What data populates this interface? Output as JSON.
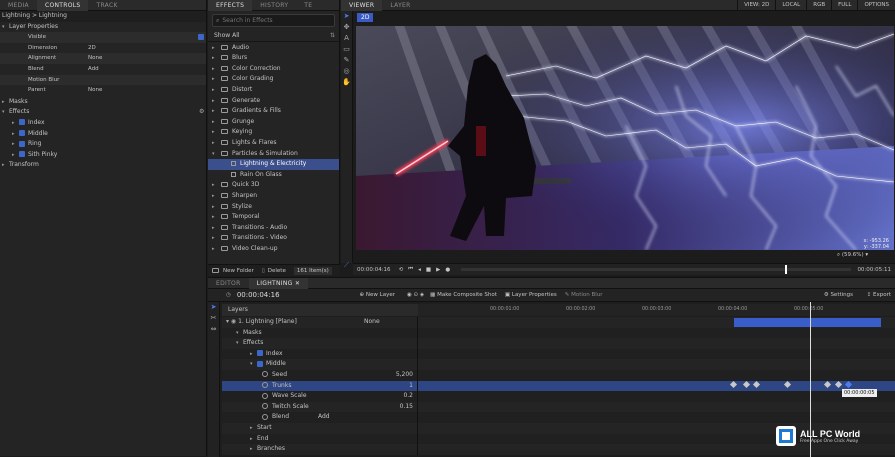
{
  "left_panel": {
    "tabs": [
      "MEDIA",
      "CONTROLS",
      "TRACK"
    ],
    "breadcrumb": "Lightning > Lightning",
    "props_title": "Layer Properties",
    "props": [
      {
        "label": "Visible",
        "value": ""
      },
      {
        "label": "Dimension",
        "value": "2D"
      },
      {
        "label": "Alignment",
        "value": "None"
      },
      {
        "label": "Blend",
        "value": "Add"
      },
      {
        "label": "Motion Blur",
        "value": ""
      },
      {
        "label": "Parent",
        "value": "None"
      }
    ],
    "masks": "Masks",
    "effects": "Effects",
    "effect_items": [
      "Index",
      "Middle",
      "Ring",
      "Sith Pinky"
    ],
    "transform": "Transform"
  },
  "effects_panel": {
    "tabs": [
      "EFFECTS",
      "HISTORY",
      "TE"
    ],
    "search_placeholder": "Search in Effects",
    "show_all": "Show All",
    "categories": [
      "Audio",
      "Blurs",
      "Color Correction",
      "Color Grading",
      "Distort",
      "Generate",
      "Gradients & Fills",
      "Grunge",
      "Keying",
      "Lights & Flares",
      "Particles & Simulation",
      "Lightning & Electricity",
      "Rain On Glass",
      "Quick 3D",
      "Sharpen",
      "Stylize",
      "Temporal",
      "Transitions - Audio",
      "Transitions - Video",
      "Video Clean-up"
    ],
    "new_folder": "New Folder",
    "delete": "Delete",
    "count": "161 Item(s)"
  },
  "viewer": {
    "tabs": [
      "VIEWER",
      "LAYER"
    ],
    "top_controls": [
      "VIEW: 2D",
      "LOCAL",
      "RGB",
      "FULL",
      "OPTIONS"
    ],
    "mode": "2D",
    "coords": [
      "x: -953.26",
      "y: -337.04"
    ],
    "time_left": "00:00:04:16",
    "time_right": "00:00:05:11",
    "zoom": "(59.6%)"
  },
  "editor": {
    "tabs": [
      "EDITOR",
      "LIGHTNING"
    ],
    "timecode": "00:00:04:16",
    "new_layer": "New Layer",
    "make_composite": "Make Composite Shot",
    "layer_properties": "Layer Properties",
    "motion_blur": "Motion Blur",
    "settings": "Settings",
    "export": "Export",
    "layers_title": "Layers",
    "ruler": [
      "00:00:01:00",
      "00:00:02:00",
      "00:00:03:00",
      "00:00:04:00",
      "00:00:05:00"
    ],
    "rows": [
      {
        "label": "1. Lightning [Plane]",
        "value": "None"
      },
      {
        "label": "Masks",
        "value": ""
      },
      {
        "label": "Effects",
        "value": ""
      },
      {
        "label": "Index",
        "value": ""
      },
      {
        "label": "Middle",
        "value": ""
      },
      {
        "label": "Seed",
        "value": "5,200"
      },
      {
        "label": "Trunks",
        "value": "1"
      },
      {
        "label": "Wave Scale",
        "value": "0.2"
      },
      {
        "label": "Twitch Scale",
        "value": "0.15"
      },
      {
        "label": "Blend",
        "value": "Add"
      },
      {
        "label": "Start",
        "value": ""
      },
      {
        "label": "End",
        "value": ""
      },
      {
        "label": "Branches",
        "value": ""
      }
    ],
    "tooltip": "00:00:00:05"
  },
  "watermark": {
    "title": "ALL PC World",
    "sub": "Free Apps One Click Away"
  }
}
